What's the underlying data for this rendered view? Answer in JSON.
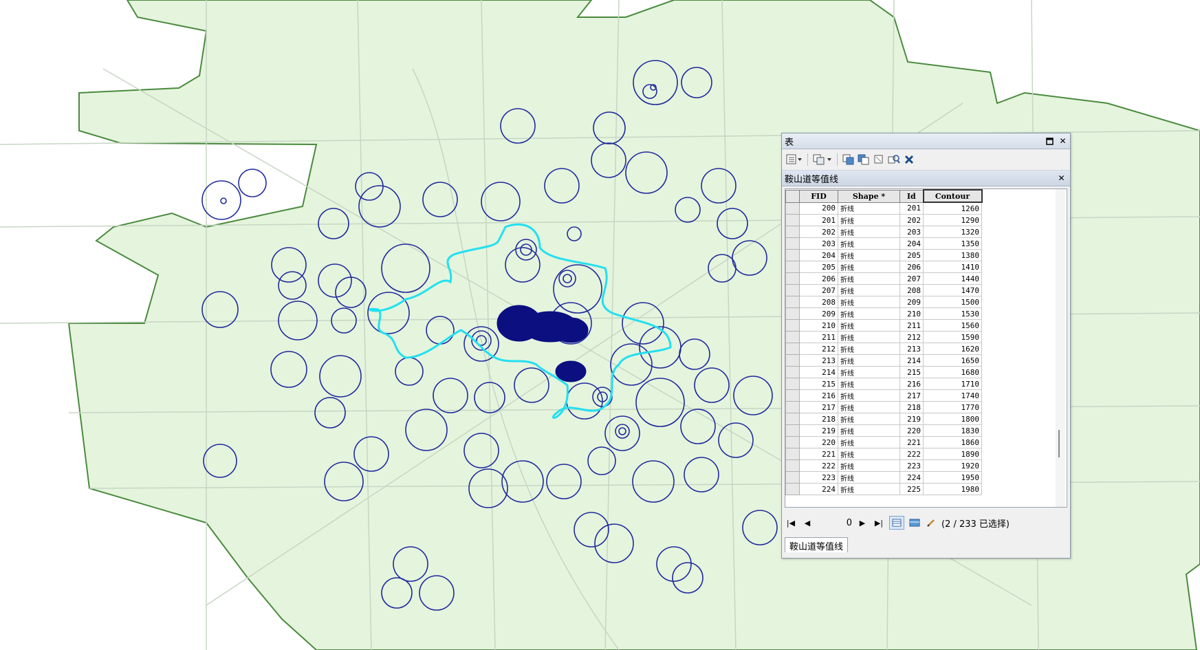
{
  "colors": {
    "map_background": "#ffffff",
    "area_fill": "#e5f4dd",
    "boundary": "#4a8a3e",
    "road": "#c7d6c4",
    "contour_dark": "#1f2a9c",
    "contour_cyan": "#22e0f0",
    "contour_core": "#0b0f80"
  },
  "window": {
    "title": "表",
    "layer_title": "鞍山道等值线",
    "tab_label": "鞍山道等值线"
  },
  "toolbar": {
    "icons": [
      "table-options-icon",
      "related-tables-icon",
      "select-by-attributes-icon",
      "switch-selection-icon",
      "clear-selection-icon",
      "zoom-to-selected-icon",
      "delete-selected-icon"
    ]
  },
  "table": {
    "columns": [
      "FID",
      "Shape *",
      "Id",
      "Contour"
    ],
    "rows": [
      [
        "200",
        "折线",
        "201",
        "1260"
      ],
      [
        "201",
        "折线",
        "202",
        "1290"
      ],
      [
        "202",
        "折线",
        "203",
        "1320"
      ],
      [
        "203",
        "折线",
        "204",
        "1350"
      ],
      [
        "204",
        "折线",
        "205",
        "1380"
      ],
      [
        "205",
        "折线",
        "206",
        "1410"
      ],
      [
        "206",
        "折线",
        "207",
        "1440"
      ],
      [
        "207",
        "折线",
        "208",
        "1470"
      ],
      [
        "208",
        "折线",
        "209",
        "1500"
      ],
      [
        "209",
        "折线",
        "210",
        "1530"
      ],
      [
        "210",
        "折线",
        "211",
        "1560"
      ],
      [
        "211",
        "折线",
        "212",
        "1590"
      ],
      [
        "212",
        "折线",
        "213",
        "1620"
      ],
      [
        "213",
        "折线",
        "214",
        "1650"
      ],
      [
        "214",
        "折线",
        "215",
        "1680"
      ],
      [
        "215",
        "折线",
        "216",
        "1710"
      ],
      [
        "216",
        "折线",
        "217",
        "1740"
      ],
      [
        "217",
        "折线",
        "218",
        "1770"
      ],
      [
        "218",
        "折线",
        "219",
        "1800"
      ],
      [
        "219",
        "折线",
        "220",
        "1830"
      ],
      [
        "220",
        "折线",
        "221",
        "1860"
      ],
      [
        "221",
        "折线",
        "222",
        "1890"
      ],
      [
        "222",
        "折线",
        "223",
        "1920"
      ],
      [
        "223",
        "折线",
        "224",
        "1950"
      ],
      [
        "224",
        "折线",
        "225",
        "1980"
      ]
    ]
  },
  "navigation": {
    "current_record": "0",
    "status": "(2 / 233 已选择)"
  }
}
